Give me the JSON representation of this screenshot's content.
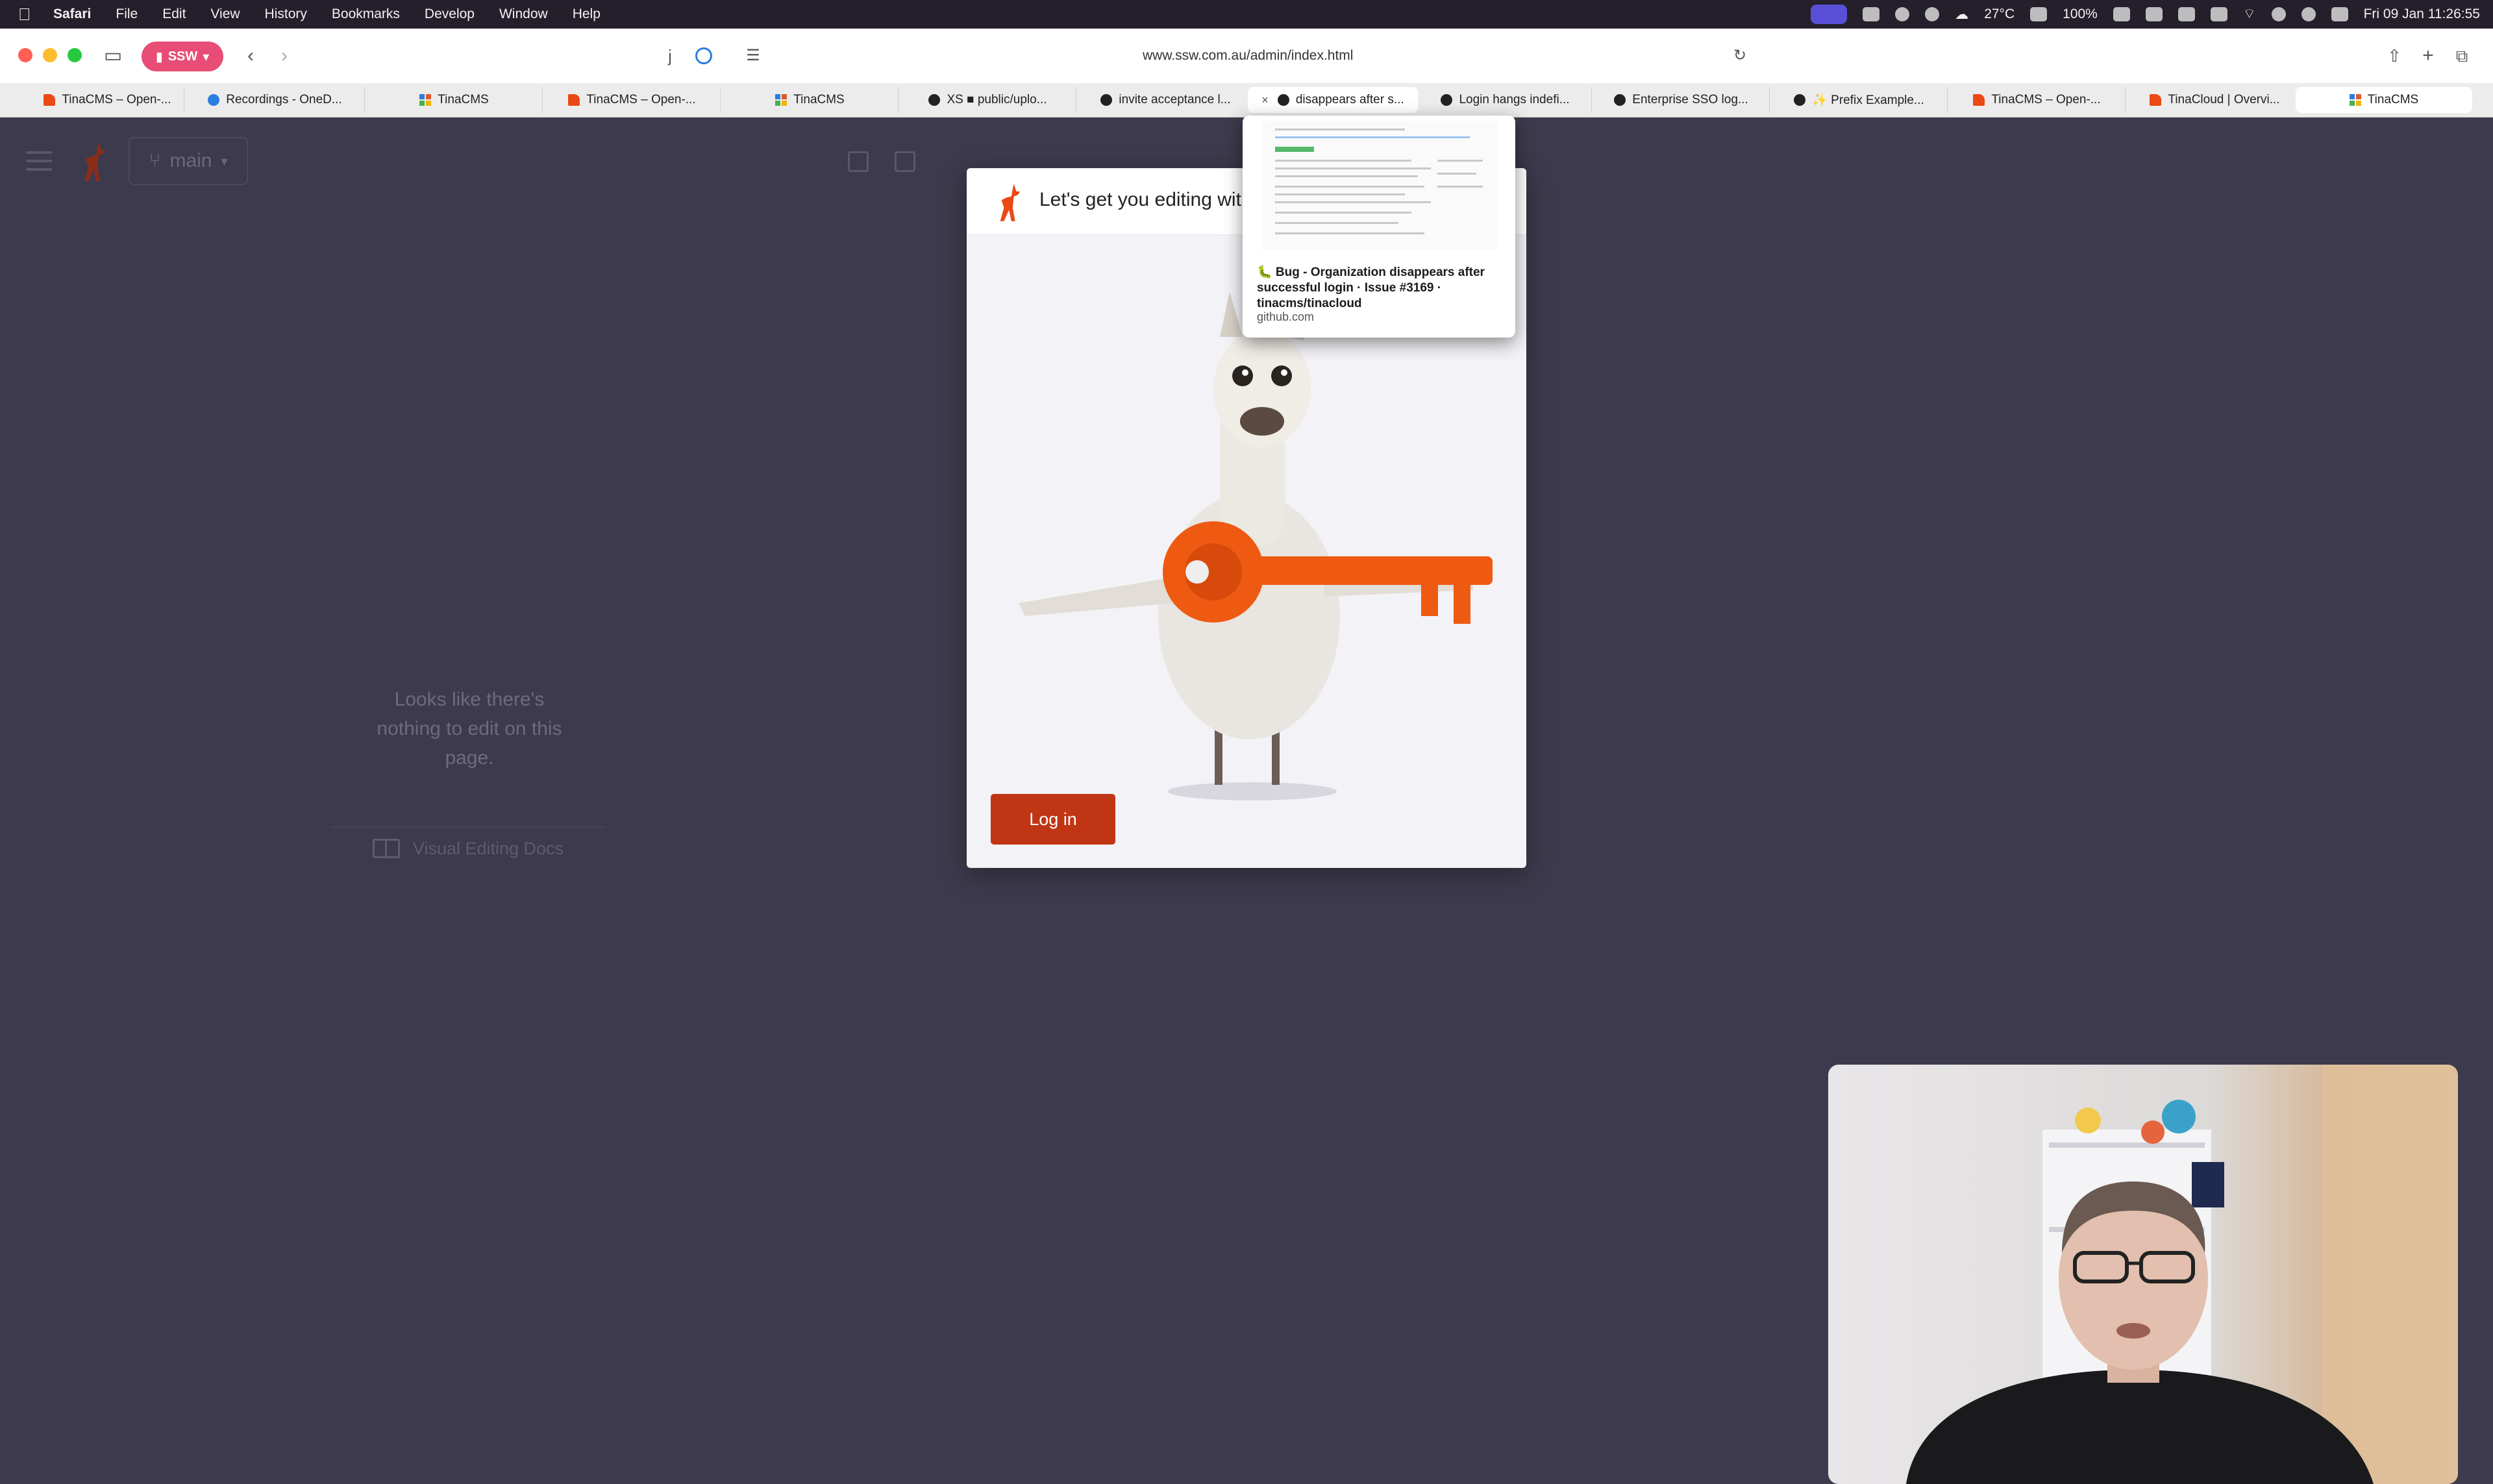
{
  "menubar": {
    "app": "Safari",
    "items": [
      "File",
      "Edit",
      "View",
      "History",
      "Bookmarks",
      "Develop",
      "Window",
      "Help"
    ],
    "weather": "27°C",
    "battery": "100%",
    "datetime": "Fri 09 Jan  11:26:55"
  },
  "browser": {
    "profile": "SSW",
    "url": "www.ssw.com.au/admin/index.html",
    "tabs": [
      {
        "label": "TinaCMS – Open-...",
        "icon": "tina"
      },
      {
        "label": "Recordings - OneD...",
        "icon": "cloud"
      },
      {
        "label": "TinaCMS",
        "icon": "grid"
      },
      {
        "label": "TinaCMS – Open-...",
        "icon": "tina"
      },
      {
        "label": "TinaCMS",
        "icon": "grid"
      },
      {
        "label": "XS  ■  public/uplo...",
        "icon": "gh"
      },
      {
        "label": "invite acceptance l...",
        "icon": "gh"
      },
      {
        "label": "disappears after s...",
        "icon": "gh"
      },
      {
        "label": "Login hangs indefi...",
        "icon": "gh"
      },
      {
        "label": "Enterprise SSO log...",
        "icon": "gh"
      },
      {
        "label": "✨ Prefix Example...",
        "icon": "gh"
      },
      {
        "label": "TinaCMS – Open-...",
        "icon": "tina"
      },
      {
        "label": "TinaCloud | Overvi...",
        "icon": "tina"
      },
      {
        "label": "TinaCMS",
        "icon": "grid"
      }
    ],
    "active_tab_index": 7
  },
  "preview": {
    "title": "🐛 Bug - Organization disappears after successful login · Issue #3169 · tinacms/tinacloud",
    "domain": "github.com"
  },
  "tina": {
    "branch": "main",
    "empty_message": "Looks like there's nothing to edit on this page.",
    "docs_label": "Visual Editing Docs"
  },
  "modal": {
    "title": "Let's get you editing with Tina",
    "login_label": "Log in"
  },
  "colors": {
    "tina_orange": "#ec4815",
    "login_button": "#c03614",
    "page_bg": "#3e3a4d"
  }
}
